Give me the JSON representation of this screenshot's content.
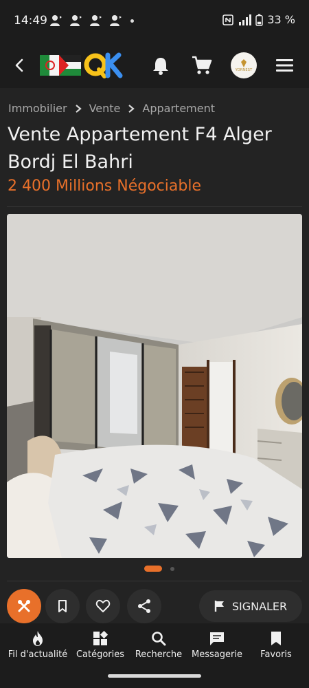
{
  "status_bar": {
    "time": "14:49",
    "battery": "33 %",
    "notification_icons": [
      "person-icon",
      "person-icon",
      "person-icon",
      "person-icon"
    ]
  },
  "app_bar": {
    "icons": [
      "back-arrow-icon",
      "bell-icon",
      "cart-icon",
      "menu-icon"
    ],
    "avatar_text": "YORNEST"
  },
  "breadcrumb": {
    "items": [
      "Immobilier",
      "Vente",
      "Appartement"
    ]
  },
  "listing": {
    "title": "Vente Appartement F4 Alger Bordj El Bahri",
    "price": "2 400 Millions Négociable",
    "photo_count": 2,
    "current_photo": 1
  },
  "actions": {
    "report_label": "SIGNALER",
    "icons": [
      "tools-icon",
      "bookmark-icon",
      "heart-icon",
      "share-icon",
      "flag-icon"
    ]
  },
  "bottom_nav": {
    "items": [
      {
        "label": "Fil d'actualité",
        "icon": "fire-icon"
      },
      {
        "label": "Catégories",
        "icon": "categories-icon"
      },
      {
        "label": "Recherche",
        "icon": "search-icon"
      },
      {
        "label": "Messagerie",
        "icon": "message-icon"
      },
      {
        "label": "Favoris",
        "icon": "bookmark-icon"
      }
    ]
  },
  "colors": {
    "accent": "#e8702a",
    "background": "#1c1c1c",
    "surface": "#232323"
  }
}
